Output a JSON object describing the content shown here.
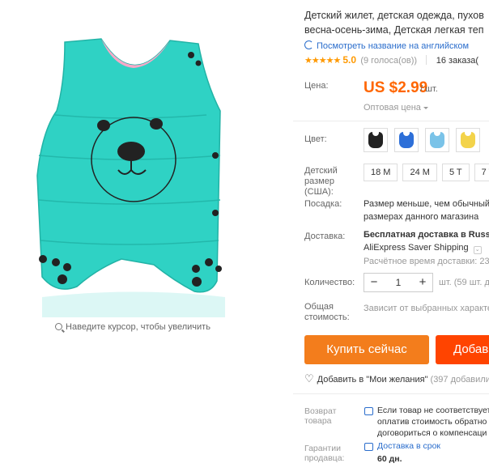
{
  "gallery": {
    "zoom_hint": "Наведите курсор, чтобы увеличить"
  },
  "product": {
    "title_line1": "Детский жилет, детская одежда, пухов",
    "title_line2": "весна-осень-зима, Детская легкая теп",
    "translate_link": "Посмотреть название на английском",
    "rating_stars": "★★★★★",
    "rating_score": "5.0",
    "rating_votes": "(9 голоса(ов))",
    "orders": "16 заказа(",
    "accent_color": "#f60"
  },
  "price": {
    "label": "Цена:",
    "value": "US $2.99",
    "unit": "/ шт.",
    "wholesale": "Оптовая цена"
  },
  "color": {
    "label": "Цвет:",
    "swatches": [
      {
        "name": "black",
        "hex": "#222222"
      },
      {
        "name": "blue",
        "hex": "#2d6fd8"
      },
      {
        "name": "light-blue",
        "hex": "#7ac3e8"
      },
      {
        "name": "yellow",
        "hex": "#f3d34a"
      }
    ]
  },
  "size": {
    "label": "Детский размер (США):",
    "options": [
      "18 M",
      "24 M",
      "5 T",
      "7 T"
    ]
  },
  "fit": {
    "label": "Посадка:",
    "line1": "Размер меньше, чем обычный.",
    "line2": "размерах данного магазина"
  },
  "shipping": {
    "label": "Доставка:",
    "line1": "Бесплатная доставка в Russia",
    "line2": "AliExpress Saver Shipping",
    "line3": "Расчётное время доставки: 23-"
  },
  "quantity": {
    "label": "Количество:",
    "minus": "−",
    "value": "1",
    "plus": "+",
    "note": "шт. (59 шт. д"
  },
  "total": {
    "label_line1": "Общая",
    "label_line2": "стоимость:",
    "value": "Зависит от выбранных характер"
  },
  "actions": {
    "buy": "Купить сейчас",
    "cart": "Добав",
    "wishlist": "Добавить в \"Мои желания\"",
    "wishlist_count": "(397 добавили"
  },
  "guarantees": {
    "return_label_1": "Возврат",
    "return_label_2": "товара",
    "return_line1": "Если товар не соответствует",
    "return_line2": "оплатив стоимость обратно",
    "return_line3": "договориться о компенсаци",
    "seller_label_1": "Гарантии",
    "seller_label_2": "продавца:",
    "seller_line1": "Доставка в срок",
    "seller_line2": "60 дн."
  }
}
